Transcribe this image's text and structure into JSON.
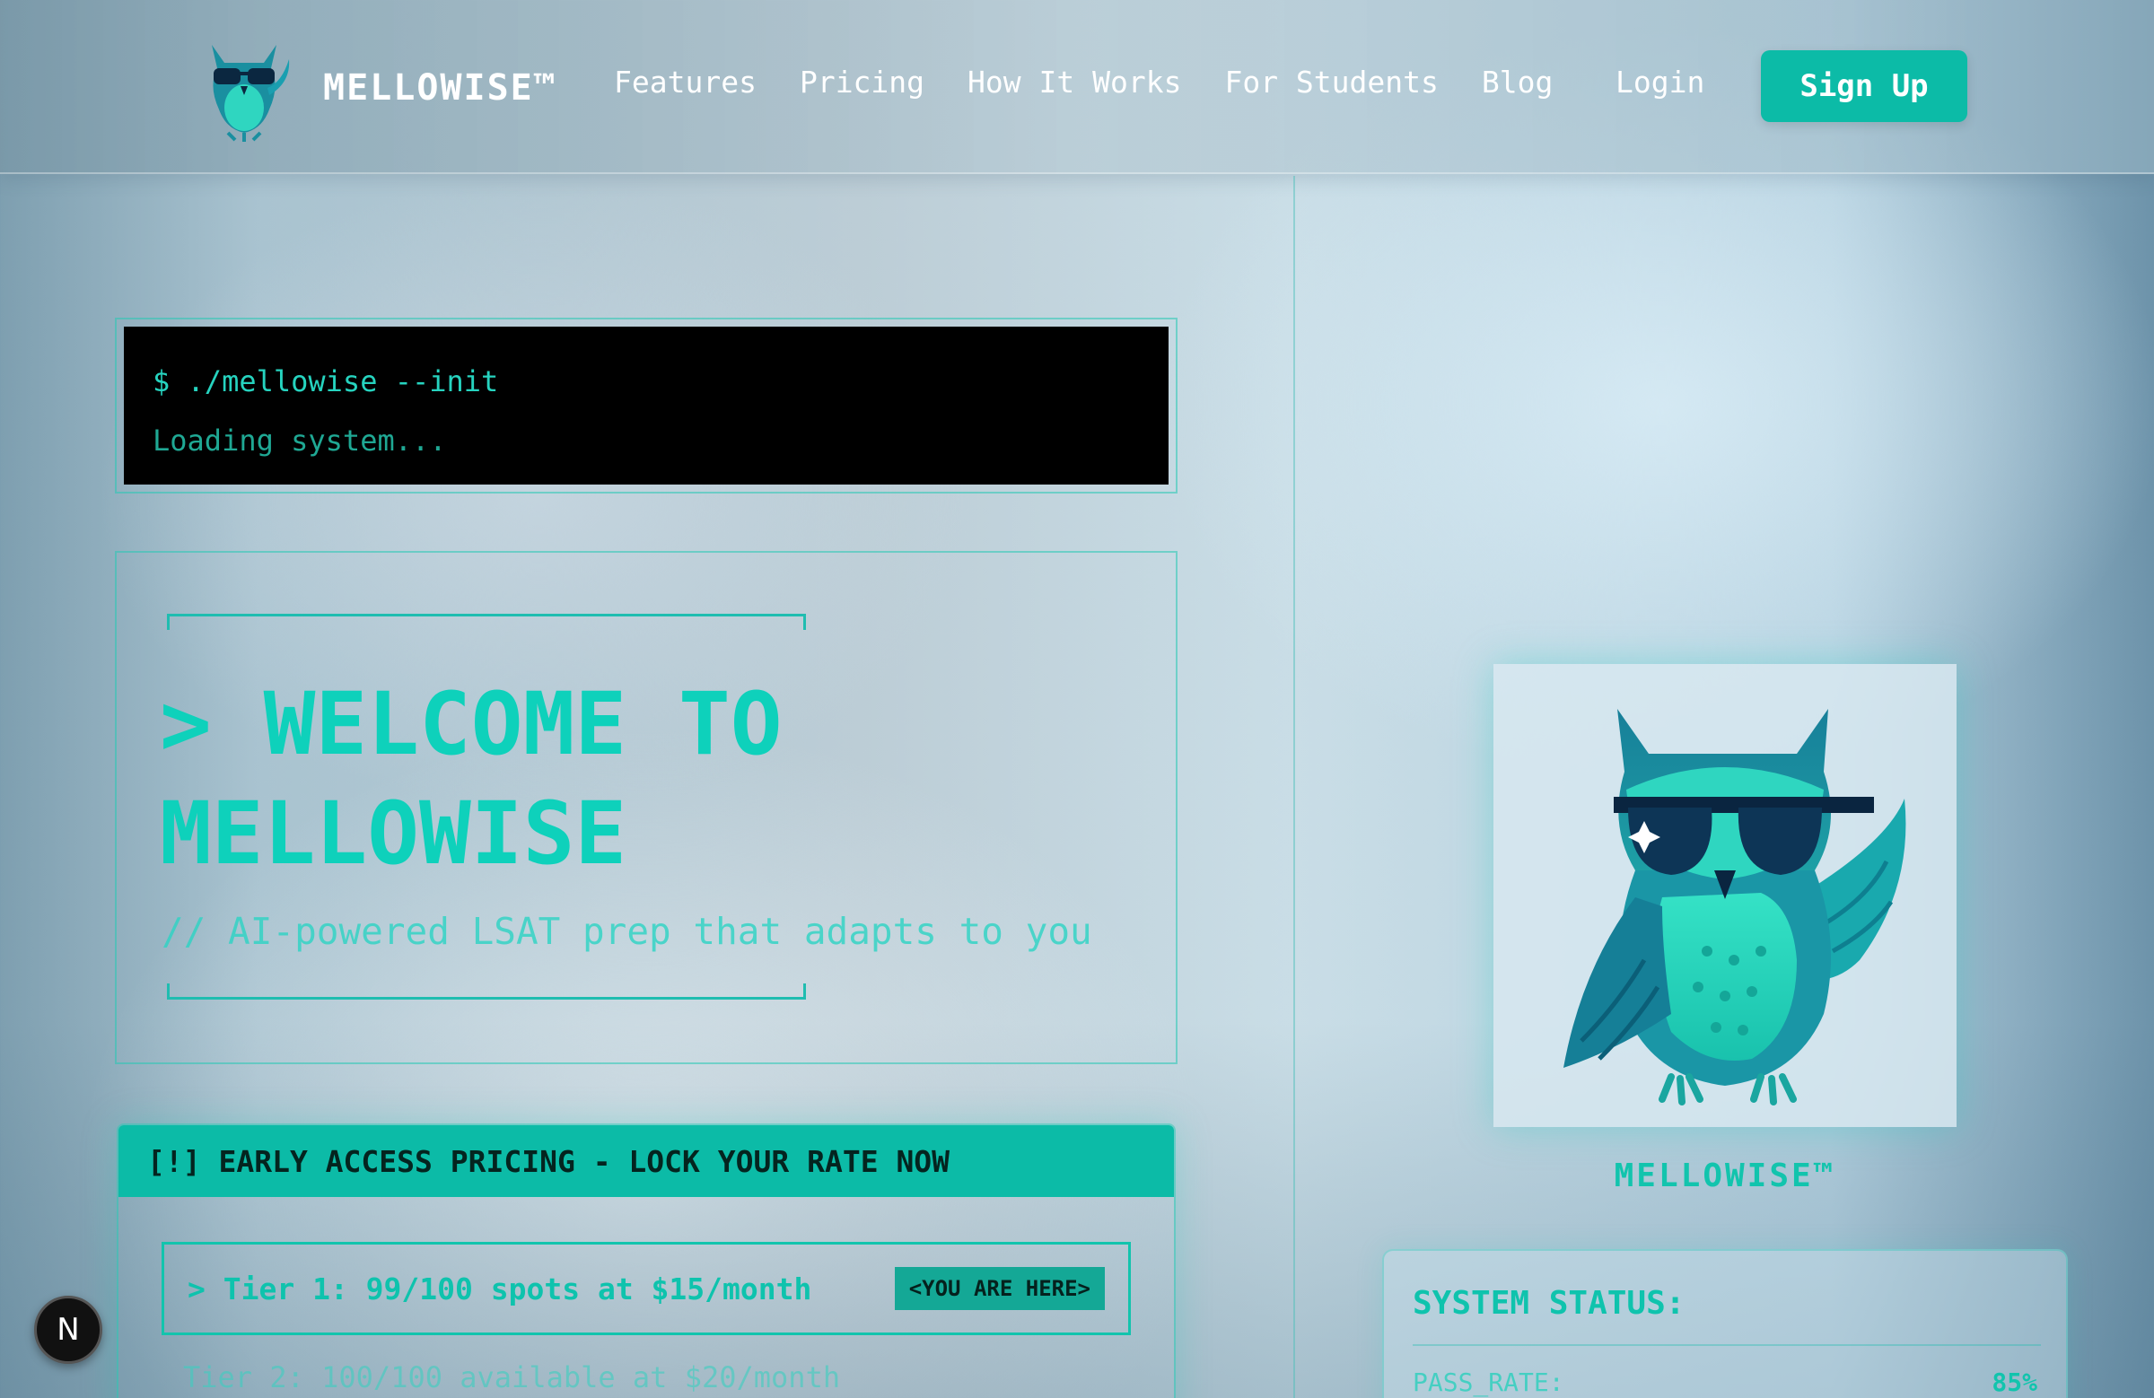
{
  "nav": {
    "brand": "MELLOWISE™",
    "links": [
      "Features",
      "Pricing",
      "How It Works",
      "For Students",
      "Blog"
    ],
    "login": "Login",
    "signup": "Sign Up"
  },
  "terminal": {
    "command": "$ ./mellowise --init",
    "status": "Loading system..."
  },
  "welcome": {
    "title": "> WELCOME TO MELLOWISE",
    "subtitle": "// AI-powered LSAT prep that adapts to you"
  },
  "pricing": {
    "header": "[!] EARLY ACCESS PRICING - LOCK YOUR RATE NOW",
    "tier1": "> Tier 1: 99/100 spots at $15/month",
    "tier1_badge": "<YOU ARE HERE>",
    "tier2": "Tier 2: 100/100 available at $20/month"
  },
  "hero": {
    "caption": "MELLOWISE™"
  },
  "status": {
    "title": "SYSTEM STATUS:",
    "key": "PASS_RATE:",
    "value": "85%"
  },
  "next_badge": "N",
  "colors": {
    "accent": "#0cbba7",
    "terminal_bg": "#000000",
    "text_accent": "#0ed1bb"
  },
  "icons": [
    "owl-logo-icon",
    "owl-mascot-icon",
    "next-n-icon"
  ]
}
